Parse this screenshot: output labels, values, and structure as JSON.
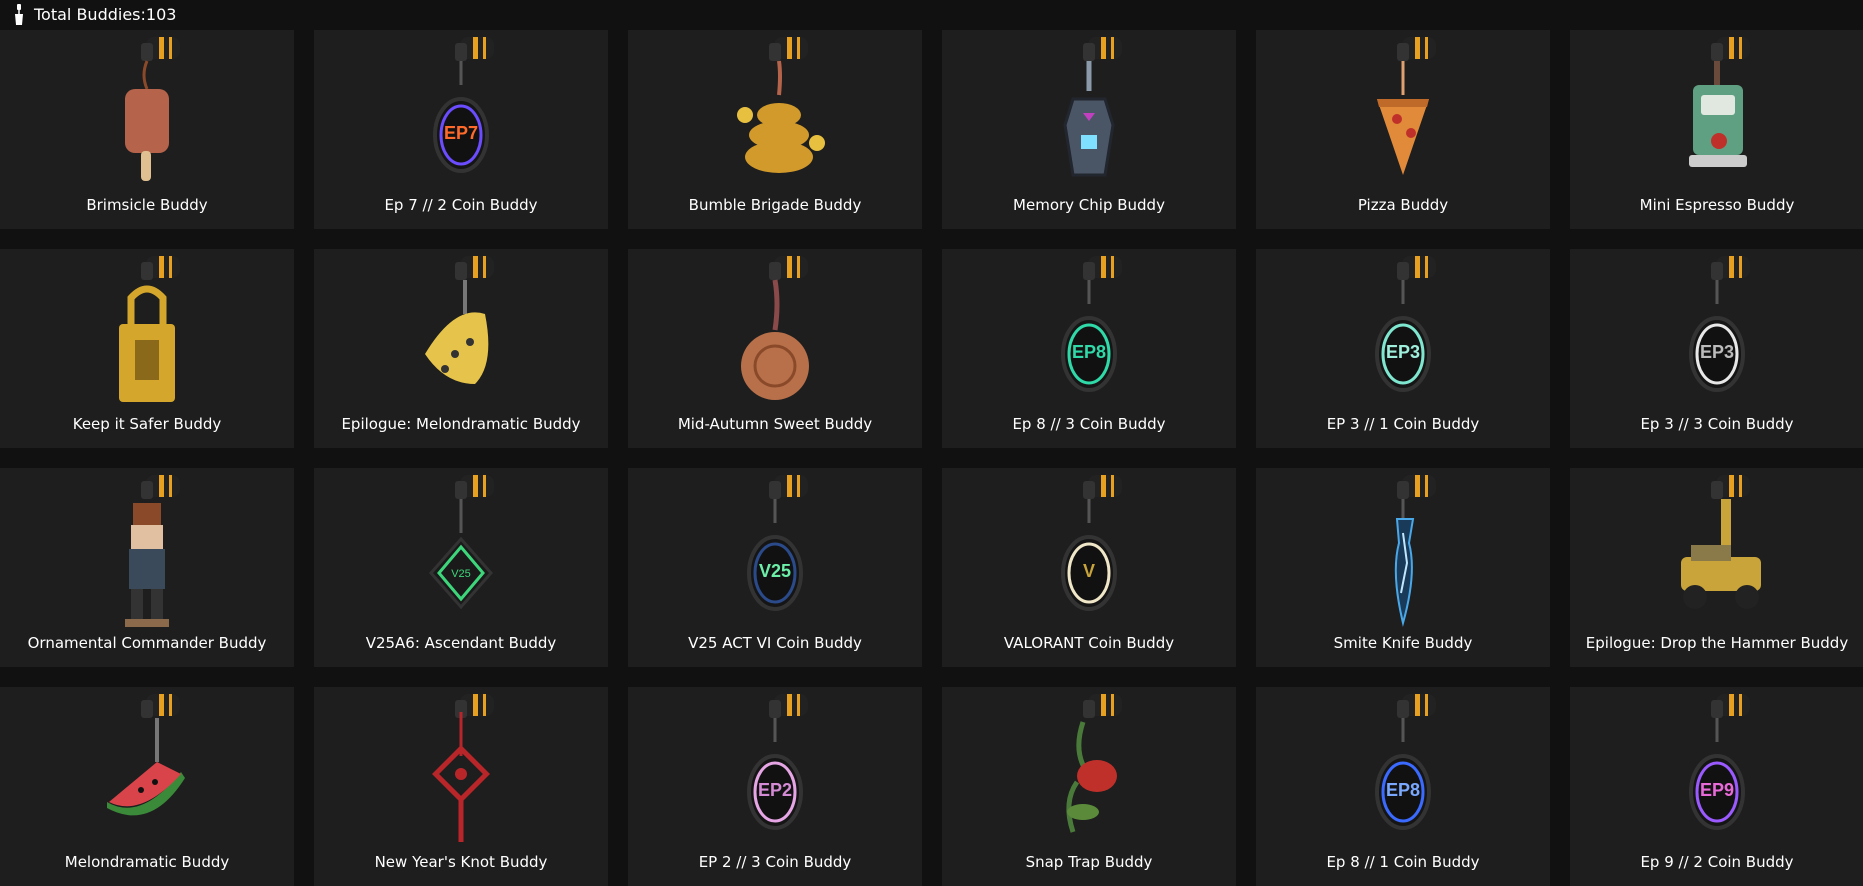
{
  "header": {
    "title": "Total Buddies:103",
    "icon": "buddy-keychain-icon"
  },
  "buddies": [
    {
      "label": "Brimsicle Buddy",
      "icon": "popsicle",
      "color": "#b5634a"
    },
    {
      "label": "Ep 7 // 2 Coin Buddy",
      "icon": "coin",
      "color": "#6b4cff",
      "coin_text": "EP7",
      "text_color": "#ff6a2a"
    },
    {
      "label": "Bumble Brigade Buddy",
      "icon": "hive",
      "color": "#d29a2a"
    },
    {
      "label": "Memory Chip Buddy",
      "icon": "chip",
      "color": "#4a5566"
    },
    {
      "label": "Pizza Buddy",
      "icon": "pizza",
      "color": "#e08a3a"
    },
    {
      "label": "Mini Espresso Buddy",
      "icon": "espresso",
      "color": "#5fa082"
    },
    {
      "label": "Keep it Safer Buddy",
      "icon": "padlock",
      "color": "#d4a72c"
    },
    {
      "label": "Epilogue: Melondramatic Buddy",
      "icon": "cheese",
      "color": "#e6c34a"
    },
    {
      "label": "Mid-Autumn Sweet Buddy",
      "icon": "mooncake",
      "color": "#b8704a"
    },
    {
      "label": "Ep 8 // 3 Coin Buddy",
      "icon": "coin",
      "color": "#2fd9a8",
      "coin_text": "EP8",
      "text_color": "#2fd9a8"
    },
    {
      "label": "EP 3 // 1 Coin Buddy",
      "icon": "coin",
      "color": "#7fe6d0",
      "coin_text": "EP3",
      "text_color": "#9ef0dd"
    },
    {
      "label": "Ep 3 // 3 Coin Buddy",
      "icon": "coin",
      "color": "#e8e8e8",
      "coin_text": "EP3",
      "text_color": "#bbbbbb"
    },
    {
      "label": "Ornamental Commander Buddy",
      "icon": "nutcracker",
      "color": "#8a5a3a"
    },
    {
      "label": "V25A6: Ascendant Buddy",
      "icon": "diamond",
      "color": "#3dd67a"
    },
    {
      "label": "V25 ACT VI Coin Buddy",
      "icon": "coin",
      "color": "#2a4a8a",
      "coin_text": "V25",
      "text_color": "#6cf0a8"
    },
    {
      "label": "VALORANT Coin Buddy",
      "icon": "coin",
      "color": "#efe7c8",
      "coin_text": "V",
      "text_color": "#c9a43a"
    },
    {
      "label": "Smite Knife Buddy",
      "icon": "knife",
      "color": "#4aa8e8"
    },
    {
      "label": "Epilogue: Drop the Hammer Buddy",
      "icon": "truck",
      "color": "#c9a43a"
    },
    {
      "label": "Melondramatic Buddy",
      "icon": "melon",
      "color": "#d9444a"
    },
    {
      "label": "New Year's Knot Buddy",
      "icon": "knot",
      "color": "#b8262a"
    },
    {
      "label": "EP 2 // 3 Coin Buddy",
      "icon": "coin",
      "color": "#e6a6e6",
      "coin_text": "EP2",
      "text_color": "#d48ad4"
    },
    {
      "label": "Snap Trap Buddy",
      "icon": "plant",
      "color": "#4a7a3a"
    },
    {
      "label": "Ep 8 // 1 Coin Buddy",
      "icon": "coin",
      "color": "#3a6aff",
      "coin_text": "EP8",
      "text_color": "#7aa8ff"
    },
    {
      "label": "Ep 9 // 2 Coin Buddy",
      "icon": "coin",
      "color": "#9a5aff",
      "coin_text": "EP9",
      "text_color": "#e86ad8"
    }
  ]
}
